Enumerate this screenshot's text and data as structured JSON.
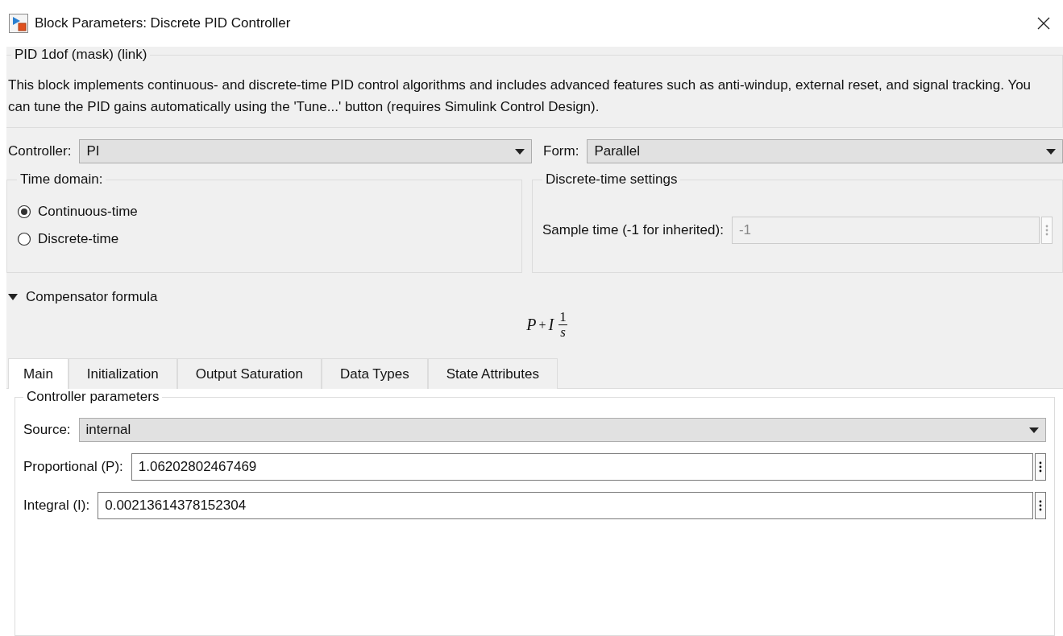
{
  "window": {
    "title": "Block Parameters: Discrete PID Controller"
  },
  "mask": {
    "title": "PID 1dof (mask) (link)",
    "description": "This block implements continuous- and discrete-time PID control algorithms and includes advanced features such as anti-windup, external reset, and signal tracking. You can tune the PID gains automatically using the 'Tune...' button (requires Simulink Control Design)."
  },
  "selectors": [
    {
      "label": "Controller:",
      "value": "PI"
    },
    {
      "label": "Form:",
      "value": "Parallel"
    }
  ],
  "time_domain": {
    "title": "Time domain:",
    "options": [
      {
        "label": "Continuous-time",
        "selected": true
      },
      {
        "label": "Discrete-time",
        "selected": false
      }
    ]
  },
  "discrete_settings": {
    "title": "Discrete-time settings",
    "field": {
      "label": "Sample time (-1 for inherited):",
      "value": "-1",
      "disabled": true
    }
  },
  "compensator": {
    "label": "Compensator formula",
    "expanded": true,
    "formula": {
      "term1": "P",
      "operator": "+",
      "term2": "I",
      "numerator": "1",
      "denominator": "s"
    }
  },
  "tabs": [
    {
      "label": "Main",
      "selected": true
    },
    {
      "label": "Initialization",
      "selected": false
    },
    {
      "label": "Output Saturation",
      "selected": false
    },
    {
      "label": "Data Types",
      "selected": false
    },
    {
      "label": "State Attributes",
      "selected": false
    }
  ],
  "controller_parameters": {
    "title": "Controller parameters",
    "source": {
      "label": "Source:",
      "value": "internal"
    },
    "fields": [
      {
        "label": "Proportional (P):",
        "value": "1.06202802467469",
        "disabled": false
      },
      {
        "label": "Integral (I):",
        "value": "0.00213614378152304",
        "disabled": false
      }
    ]
  }
}
